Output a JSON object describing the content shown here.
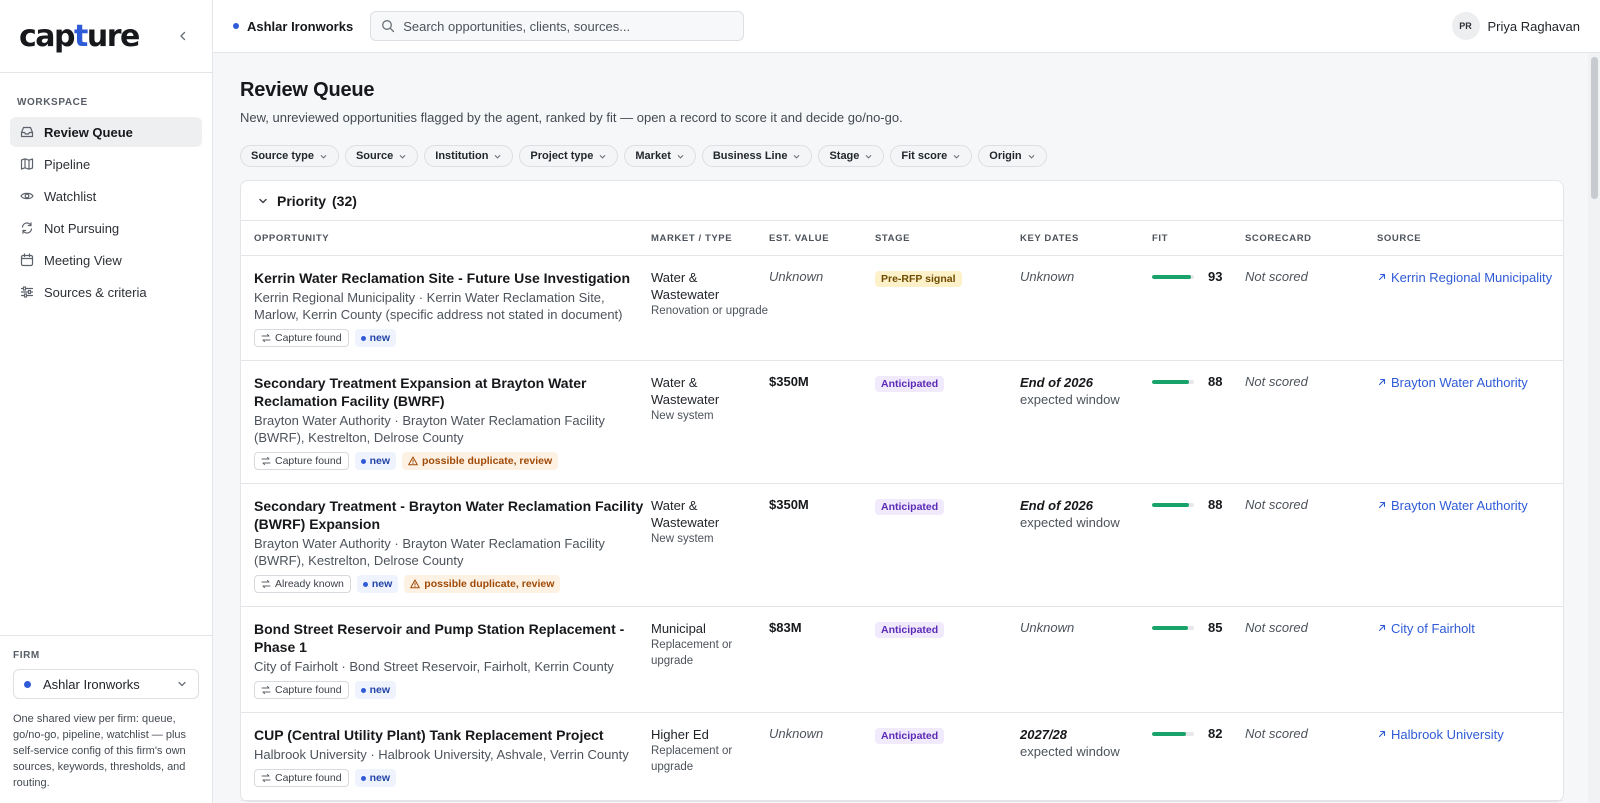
{
  "brand": {
    "logo_prefix": "cap",
    "logo_accent": "t",
    "logo_suffix": "ure"
  },
  "sidebar": {
    "section_label": "WORKSPACE",
    "items": [
      {
        "label": "Review Queue",
        "icon": "inbox-icon",
        "active": true
      },
      {
        "label": "Pipeline",
        "icon": "map-icon"
      },
      {
        "label": "Watchlist",
        "icon": "eye-icon"
      },
      {
        "label": "Not Pursuing",
        "icon": "refresh-icon"
      },
      {
        "label": "Meeting View",
        "icon": "calendar-icon"
      },
      {
        "label": "Sources & criteria",
        "icon": "sliders-icon"
      }
    ],
    "firm_label": "FIRM",
    "firm_name": "Ashlar Ironworks",
    "firm_note": "One shared view per firm: queue, go/no-go, pipeline, watchlist — plus self-service config of this firm's own sources, keywords, thresholds, and routing."
  },
  "topbar": {
    "workspace": "Ashlar Ironworks",
    "search_placeholder": "Search opportunities, clients, sources...",
    "user_initials": "PR",
    "user_name": "Priya Raghavan"
  },
  "page": {
    "title": "Review Queue",
    "subtitle": "New, unreviewed opportunities flagged by the agent, ranked by fit — open a record to score it and decide go/no-go."
  },
  "filters": [
    "Source type",
    "Source",
    "Institution",
    "Project type",
    "Market",
    "Business Line",
    "Stage",
    "Fit score",
    "Origin"
  ],
  "group": {
    "title": "Priority",
    "count": "(32)"
  },
  "columns": {
    "opportunity": "OPPORTUNITY",
    "market": "MARKET / TYPE",
    "value": "EST. VALUE",
    "stage": "STAGE",
    "dates": "KEY DATES",
    "fit": "FIT",
    "scorecard": "SCORECARD",
    "source": "SOURCE"
  },
  "rows": [
    {
      "title": "Kerrin Water Reclamation Site - Future Use Investigation",
      "subtitle": "Kerrin Regional Municipality · Kerrin Water Reclamation Site, Marlow, Kerrin County (specific address not stated in document)",
      "origin": "Capture found",
      "new_label": "new",
      "duplicate": "",
      "market_main": "Water & Wastewater",
      "market_sub": "Renovation or upgrade",
      "value": "Unknown",
      "value_known": false,
      "stage": "Pre-RFP signal",
      "stage_kind": "pre",
      "date_main": "Unknown",
      "date_sub": "",
      "date_known": false,
      "fit": 93,
      "scorecard": "Not scored",
      "source": "Kerrin Regional Municipality"
    },
    {
      "title": "Secondary Treatment Expansion at Brayton Water Reclamation Facility (BWRF)",
      "subtitle": "Brayton Water Authority · Brayton Water Reclamation Facility (BWRF), Kestrelton, Delrose County",
      "origin": "Capture found",
      "new_label": "new",
      "duplicate": "possible duplicate, review",
      "market_main": "Water & Wastewater",
      "market_sub": "New system",
      "value": "$350M",
      "value_known": true,
      "stage": "Anticipated",
      "stage_kind": "ant",
      "date_main": "End of 2026",
      "date_sub": "expected window",
      "date_known": true,
      "fit": 88,
      "scorecard": "Not scored",
      "source": "Brayton Water Authority"
    },
    {
      "title": "Secondary Treatment - Brayton Water Reclamation Facility (BWRF) Expansion",
      "subtitle": "Brayton Water Authority · Brayton Water Reclamation Facility (BWRF), Kestrelton, Delrose County",
      "origin": "Already known",
      "new_label": "new",
      "duplicate": "possible duplicate, review",
      "market_main": "Water & Wastewater",
      "market_sub": "New system",
      "value": "$350M",
      "value_known": true,
      "stage": "Anticipated",
      "stage_kind": "ant",
      "date_main": "End of 2026",
      "date_sub": "expected window",
      "date_known": true,
      "fit": 88,
      "scorecard": "Not scored",
      "source": "Brayton Water Authority"
    },
    {
      "title": "Bond Street Reservoir and Pump Station Replacement - Phase 1",
      "subtitle": "City of Fairholt · Bond Street Reservoir, Fairholt, Kerrin County",
      "origin": "Capture found",
      "new_label": "new",
      "duplicate": "",
      "market_main": "Municipal",
      "market_sub": "Replacement or upgrade",
      "value": "$83M",
      "value_known": true,
      "stage": "Anticipated",
      "stage_kind": "ant",
      "date_main": "Unknown",
      "date_sub": "",
      "date_known": false,
      "fit": 85,
      "scorecard": "Not scored",
      "source": "City of Fairholt"
    },
    {
      "title": "CUP (Central Utility Plant) Tank Replacement Project",
      "subtitle": "Halbrook University · Halbrook University, Ashvale, Verrin County",
      "origin": "Capture found",
      "new_label": "new",
      "duplicate": "",
      "market_main": "Higher Ed",
      "market_sub": "Replacement or upgrade",
      "value": "Unknown",
      "value_known": false,
      "stage": "Anticipated",
      "stage_kind": "ant",
      "date_main": "2027/28",
      "date_sub": "expected window",
      "date_known": true,
      "fit": 82,
      "scorecard": "Not scored",
      "source": "Halbrook University"
    }
  ]
}
